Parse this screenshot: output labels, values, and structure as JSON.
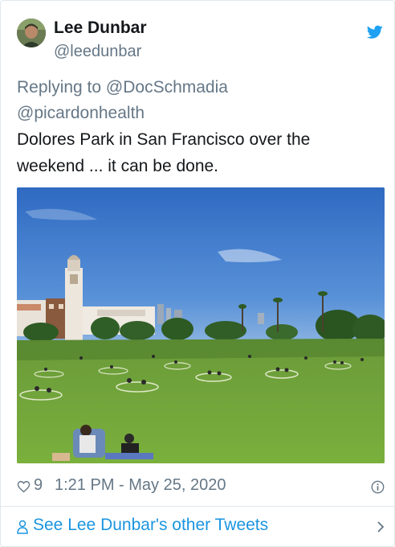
{
  "tweet": {
    "author_name": "Lee Dunbar",
    "author_handle": "@leedunbar",
    "replying_to_label": "Replying to",
    "replying_to": [
      "@DocSchmadia",
      "@picardonhealth"
    ],
    "text": "Dolores Park in San Francisco over the weekend ... it can be done.",
    "likes": "9",
    "timestamp": "1:21 PM - May 25, 2020"
  },
  "footer": {
    "link_label": "See Lee Dunbar's other Tweets"
  },
  "colors": {
    "brand": "#1da1f2",
    "link": "#1b95e0",
    "secondary_text": "#657786",
    "divider": "#e1e8ed"
  },
  "icons": [
    "twitter-bird-icon",
    "heart-icon",
    "info-icon",
    "person-icon",
    "chevron-right-icon"
  ]
}
